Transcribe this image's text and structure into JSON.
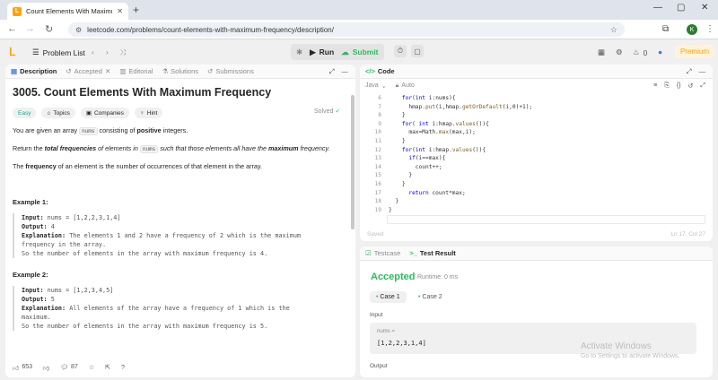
{
  "browser": {
    "tab_title": "Count Elements With Maximum",
    "url": "leetcode.com/problems/count-elements-with-maximum-frequency/description/",
    "profile_initial": "K"
  },
  "nav": {
    "problem_list": "Problem List",
    "run": "Run",
    "submit": "Submit",
    "streak": "0",
    "premium": "Premium"
  },
  "desc_tabs": {
    "description": "Description",
    "accepted": "Accepted",
    "editorial": "Editorial",
    "solutions": "Solutions",
    "submissions": "Submissions"
  },
  "problem": {
    "title": "3005. Count Elements With Maximum Frequency",
    "solved": "Solved",
    "tags": {
      "easy": "Easy",
      "topics": "Topics",
      "companies": "Companies",
      "hint": "Hint"
    },
    "p1_a": "You are given an array ",
    "p1_code": "nums",
    "p1_b": " consisting of ",
    "p1_bold": "positive",
    "p1_c": " integers.",
    "p2_a": "Return the ",
    "p2_bold1": "total frequencies",
    "p2_b": " of elements in ",
    "p2_code": "nums",
    "p2_c": " such that those elements all have the ",
    "p2_bold2": "maximum",
    "p2_d": " frequency.",
    "p3_a": "The ",
    "p3_bold": "frequency",
    "p3_b": " of an element is the number of occurrences of that element in the array.",
    "ex1": {
      "heading": "Example 1:",
      "input_label": "Input:",
      "input": " nums = [1,2,2,3,1,4]",
      "output_label": "Output:",
      "output": " 4",
      "expl_label": "Explanation:",
      "expl_l1": " The elements 1 and 2 have a frequency of 2 which is the maximum",
      "expl_l2": "frequency in the array.",
      "expl_l3": "So the number of elements in the array with maximum frequency is 4."
    },
    "ex2": {
      "heading": "Example 2:",
      "input_label": "Input:",
      "input": " nums = [1,2,3,4,5]",
      "output_label": "Output:",
      "output": " 5",
      "expl_label": "Explanation:",
      "expl_l1": " All elements of the array have a frequency of 1 which is the",
      "expl_l2": "maximum.",
      "expl_l3": "So the number of elements in the array with maximum frequency is 5."
    },
    "likes": "653",
    "comments": "87"
  },
  "code": {
    "header": "Code",
    "language": "Java",
    "mode": "Auto",
    "lines": [
      {
        "n": "6",
        "text": "    for(int i:nums){"
      },
      {
        "n": "7",
        "text": "      hmap.put(i,hmap.getOrDefault(i,0)+1);"
      },
      {
        "n": "8",
        "text": "    }"
      },
      {
        "n": "9",
        "text": "    for( int i:hmap.values()){"
      },
      {
        "n": "10",
        "text": "      max=Math.max(max,i);"
      },
      {
        "n": "11",
        "text": "    }"
      },
      {
        "n": "12",
        "text": "    for(int i:hmap.values()){"
      },
      {
        "n": "13",
        "text": "      if(i==max){"
      },
      {
        "n": "14",
        "text": "        count++;"
      },
      {
        "n": "15",
        "text": "      }"
      },
      {
        "n": "16",
        "text": "    }"
      },
      {
        "n": "17",
        "text": "      return count*max;"
      },
      {
        "n": "18",
        "text": "  }"
      },
      {
        "n": "19",
        "text": "}"
      }
    ],
    "saved": "Saved",
    "cursor": "Ln 17, Col 27"
  },
  "test": {
    "testcase_tab": "Testcase",
    "result_tab": "Test Result",
    "status": "Accepted",
    "runtime": "Runtime: 0 ms",
    "case1": "Case 1",
    "case2": "Case 2",
    "input_label": "Input",
    "var_name": "nums =",
    "var_value": "[1,2,2,3,1,4]",
    "output_label": "Output"
  },
  "watermark": {
    "line1": "Activate Windows",
    "line2": "Go to Settings to activate Windows."
  },
  "colors": {
    "accent": "#ffa116",
    "success": "#2cbb5d",
    "easy": "#00af9b"
  }
}
